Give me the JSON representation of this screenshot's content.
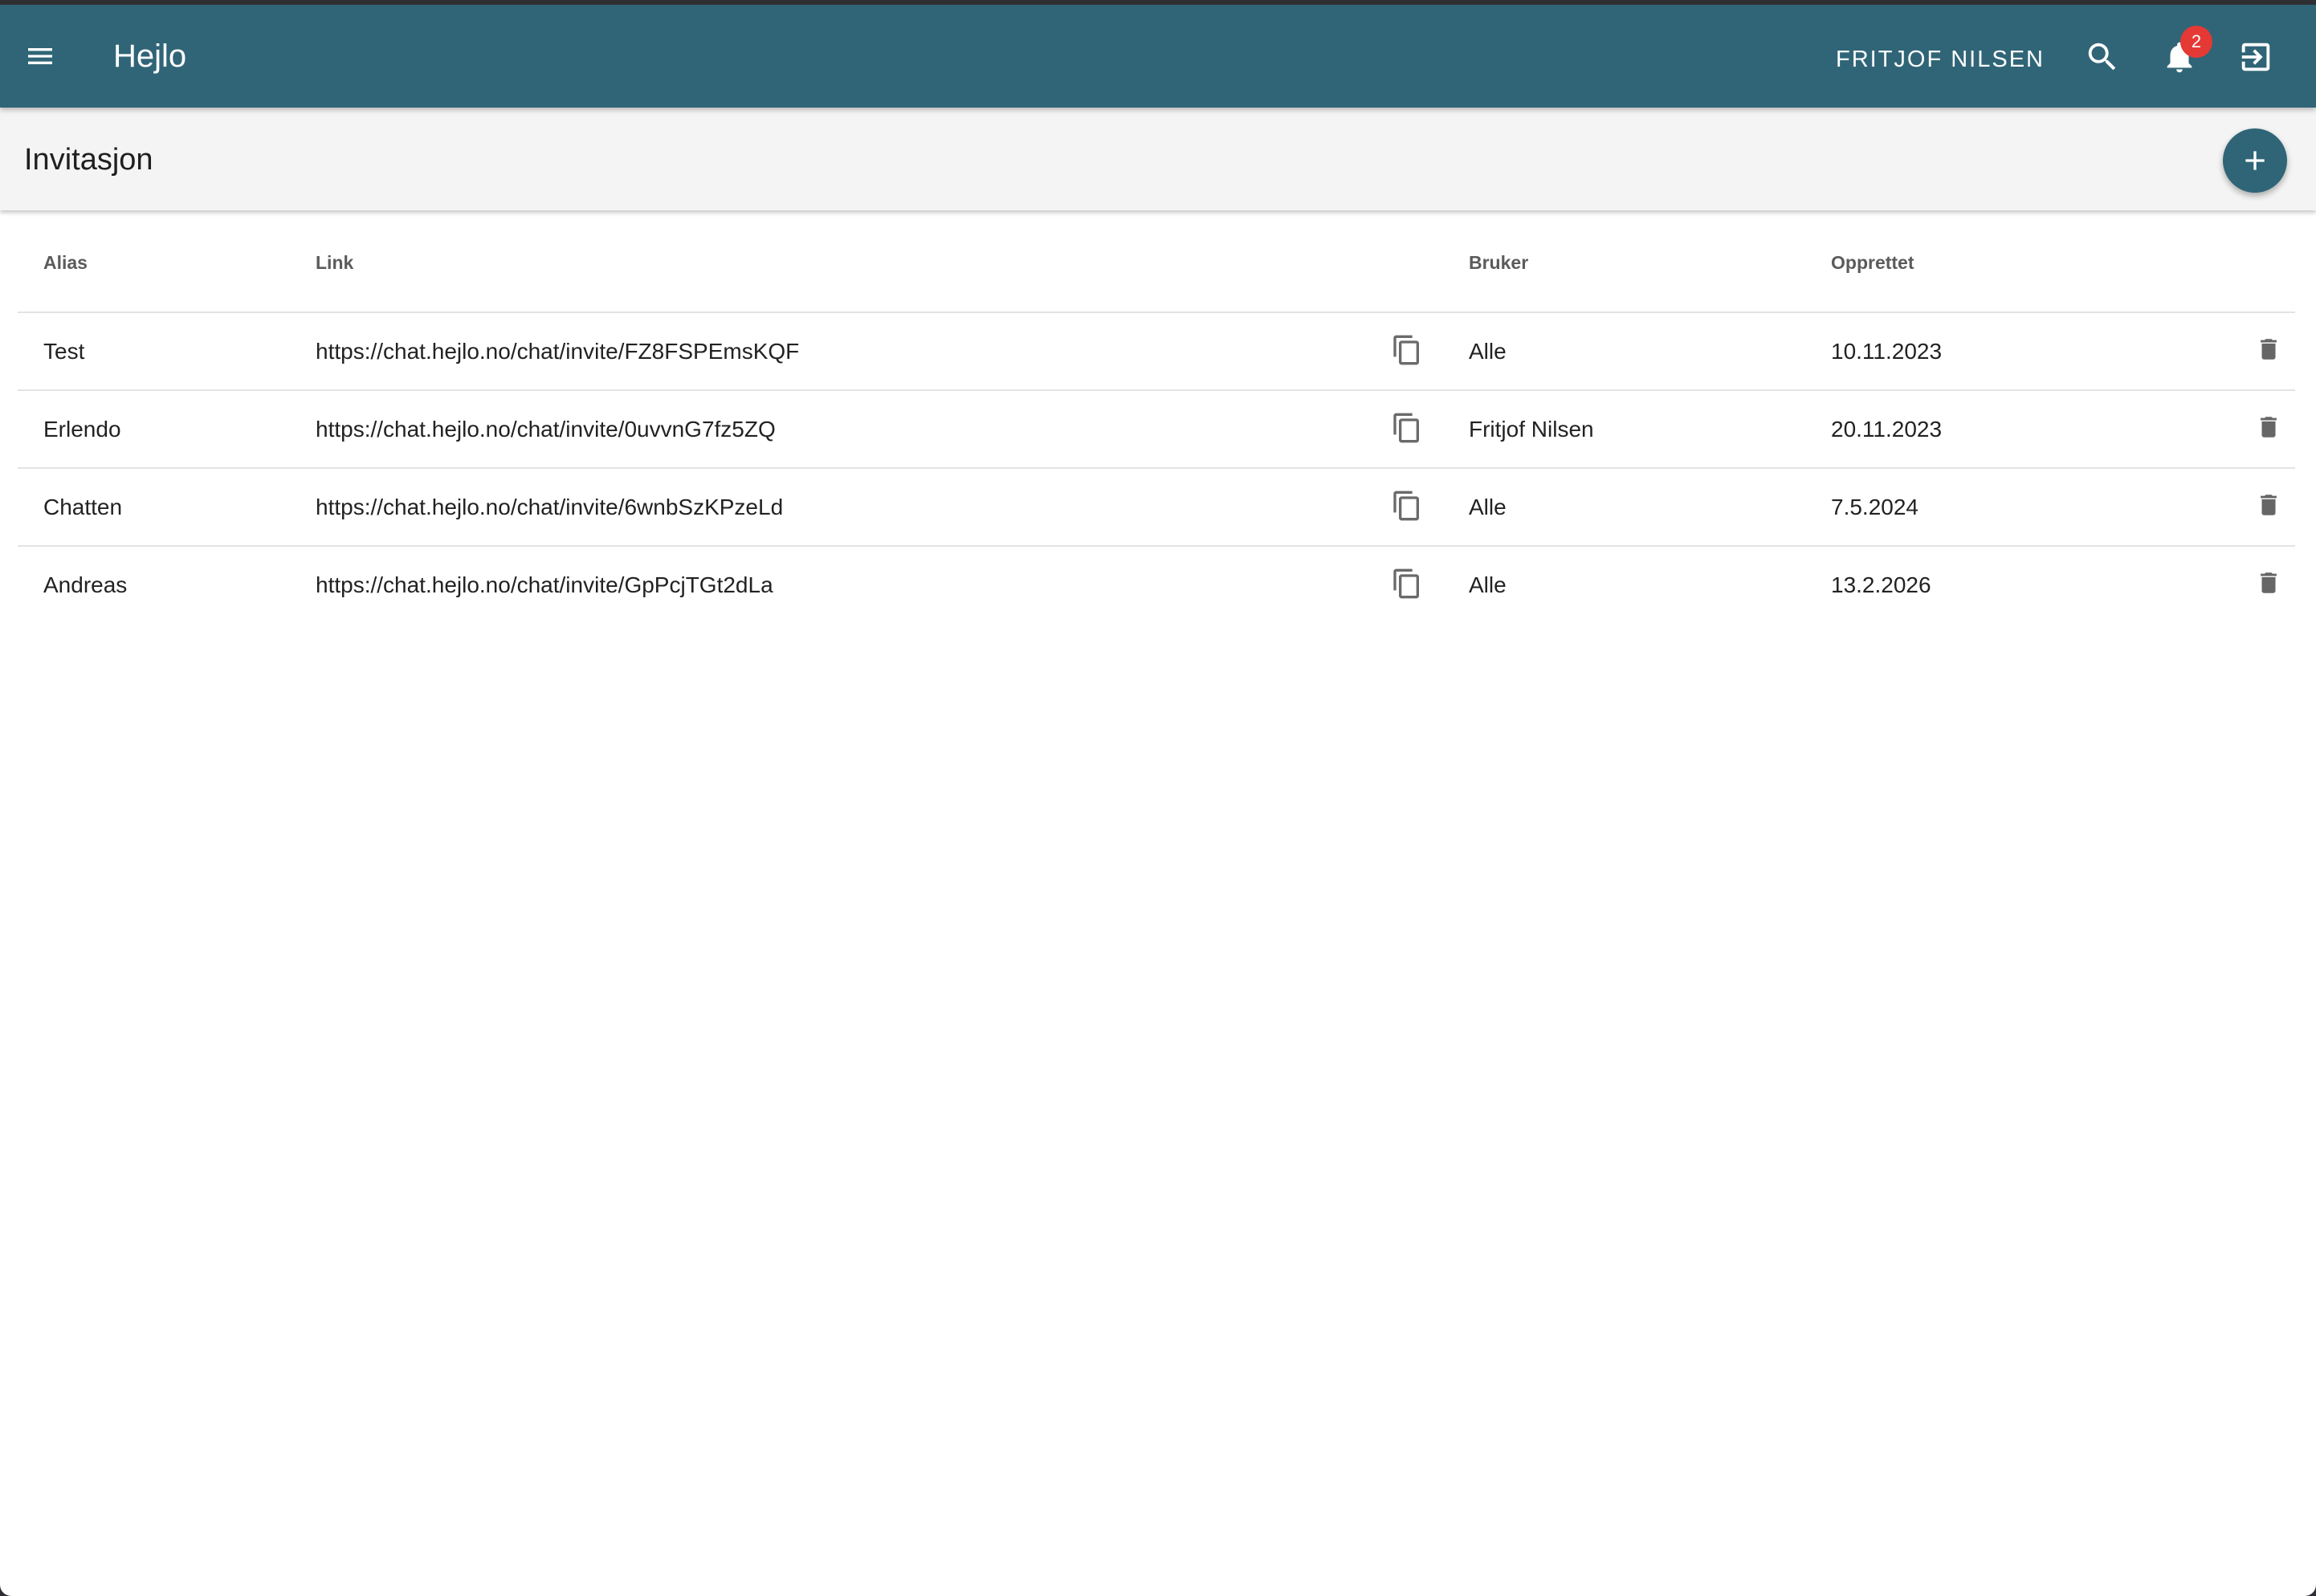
{
  "app": {
    "title": "Hejlo",
    "user_name": "FRITJOF NILSEN",
    "notification_count": "2",
    "colors": {
      "primary": "#306577",
      "badge": "#e53935",
      "subbar": "#f4f4f4"
    },
    "icons": [
      "menu-icon",
      "search-icon",
      "bell-icon",
      "logout-icon",
      "plus-icon",
      "copy-icon",
      "delete-icon"
    ]
  },
  "page": {
    "title": "Invitasjon"
  },
  "table": {
    "columns": {
      "alias": "Alias",
      "link": "Link",
      "user": "Bruker",
      "created": "Opprettet"
    },
    "rows": [
      {
        "alias": "Test",
        "link": "https://chat.hejlo.no/chat/invite/FZ8FSPEmsKQF",
        "user": "Alle",
        "created": "10.11.2023"
      },
      {
        "alias": "Erlendo",
        "link": "https://chat.hejlo.no/chat/invite/0uvvnG7fz5ZQ",
        "user": "Fritjof Nilsen",
        "created": "20.11.2023"
      },
      {
        "alias": "Chatten",
        "link": "https://chat.hejlo.no/chat/invite/6wnbSzKPzeLd",
        "user": "Alle",
        "created": "7.5.2024"
      },
      {
        "alias": "Andreas",
        "link": "https://chat.hejlo.no/chat/invite/GpPcjTGt2dLa",
        "user": "Alle",
        "created": "13.2.2026"
      }
    ]
  }
}
